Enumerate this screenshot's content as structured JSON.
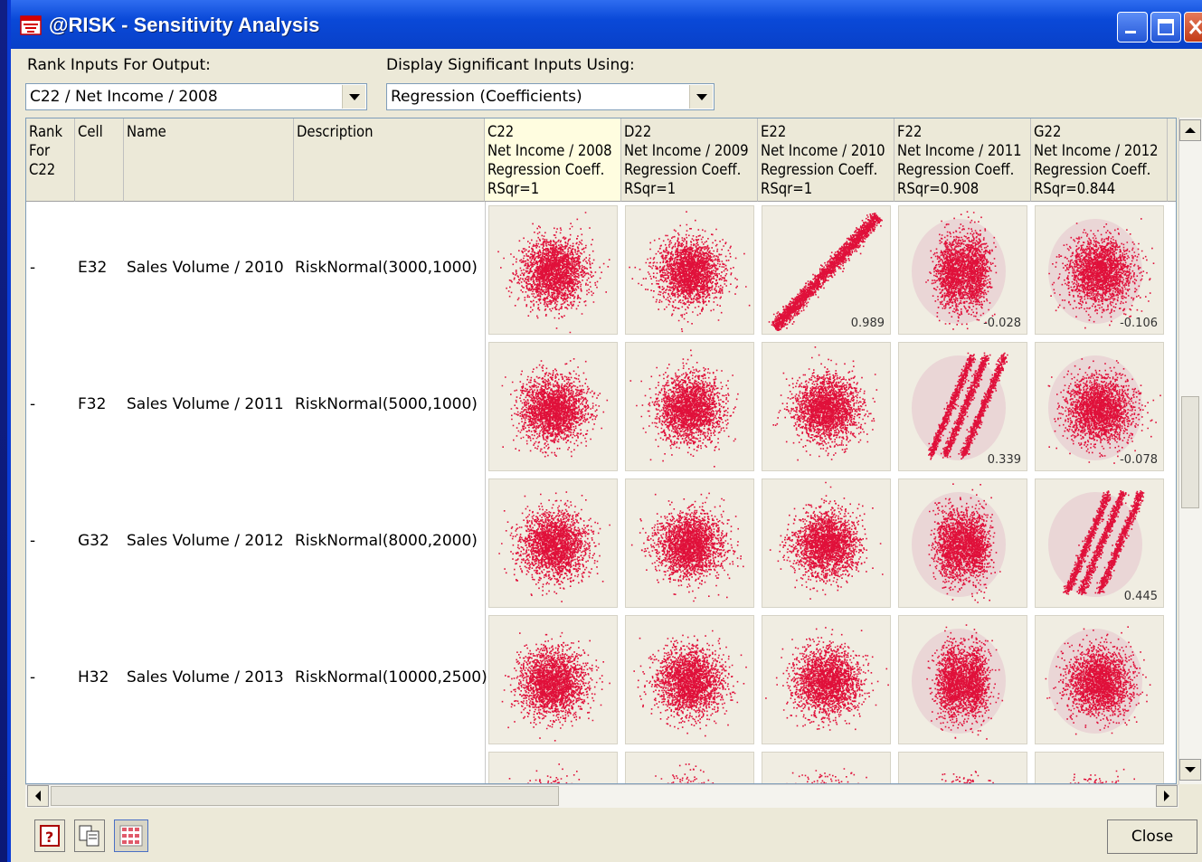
{
  "window": {
    "title": "@RISK - Sensitivity Analysis"
  },
  "controls": {
    "rank_inputs_label": "Rank Inputs For Output:",
    "rank_inputs_value": "C22 / Net Income / 2008",
    "display_label": "Display Significant Inputs Using:",
    "display_value": "Regression (Coefficients)"
  },
  "table": {
    "headers": {
      "rank": [
        "Rank",
        "For",
        "C22"
      ],
      "cell": "Cell",
      "name": "Name",
      "description": "Description"
    },
    "output_columns": [
      {
        "cell": "C22",
        "name": "Net Income / 2008",
        "stat": "Regression Coeff.",
        "rsqr": "RSqr=1"
      },
      {
        "cell": "D22",
        "name": "Net Income / 2009",
        "stat": "Regression Coeff.",
        "rsqr": "RSqr=1"
      },
      {
        "cell": "E22",
        "name": "Net Income / 2010",
        "stat": "Regression Coeff.",
        "rsqr": "RSqr=1"
      },
      {
        "cell": "F22",
        "name": "Net Income / 2011",
        "stat": "Regression Coeff.",
        "rsqr": "RSqr=0.908"
      },
      {
        "cell": "G22",
        "name": "Net Income / 2012",
        "stat": "Regression Coeff.",
        "rsqr": "RSqr=0.844"
      }
    ],
    "rows": [
      {
        "rank": "-",
        "cell": "E32",
        "name": "Sales Volume / 2010",
        "description": "RiskNormal(3000,1000)",
        "values": [
          "",
          "",
          "0.989",
          "-0.028",
          "-0.106"
        ],
        "plots": [
          "blob",
          "blob",
          "line",
          "split",
          "blob-shadow"
        ]
      },
      {
        "rank": "-",
        "cell": "F32",
        "name": "Sales Volume / 2011",
        "description": "RiskNormal(5000,1000)",
        "values": [
          "",
          "",
          "",
          "0.339",
          "-0.078"
        ],
        "plots": [
          "blob",
          "blob",
          "blob",
          "streaks",
          "blob-shadow"
        ]
      },
      {
        "rank": "-",
        "cell": "G32",
        "name": "Sales Volume / 2012",
        "description": "RiskNormal(8000,2000)",
        "values": [
          "",
          "",
          "",
          "",
          "0.445"
        ],
        "plots": [
          "blob",
          "blob",
          "blob",
          "split",
          "streaks"
        ]
      },
      {
        "rank": "-",
        "cell": "H32",
        "name": "Sales Volume / 2013",
        "description": "RiskNormal(10000,2500)",
        "values": [
          "",
          "",
          "",
          "",
          ""
        ],
        "plots": [
          "blob",
          "blob",
          "blob",
          "split",
          "blob-shadow"
        ]
      }
    ]
  },
  "buttons": {
    "close": "Close"
  },
  "colors": {
    "scatter": "#e0103a",
    "title_bar": "#0a49d8",
    "dialog_bg": "#ece9d8"
  }
}
